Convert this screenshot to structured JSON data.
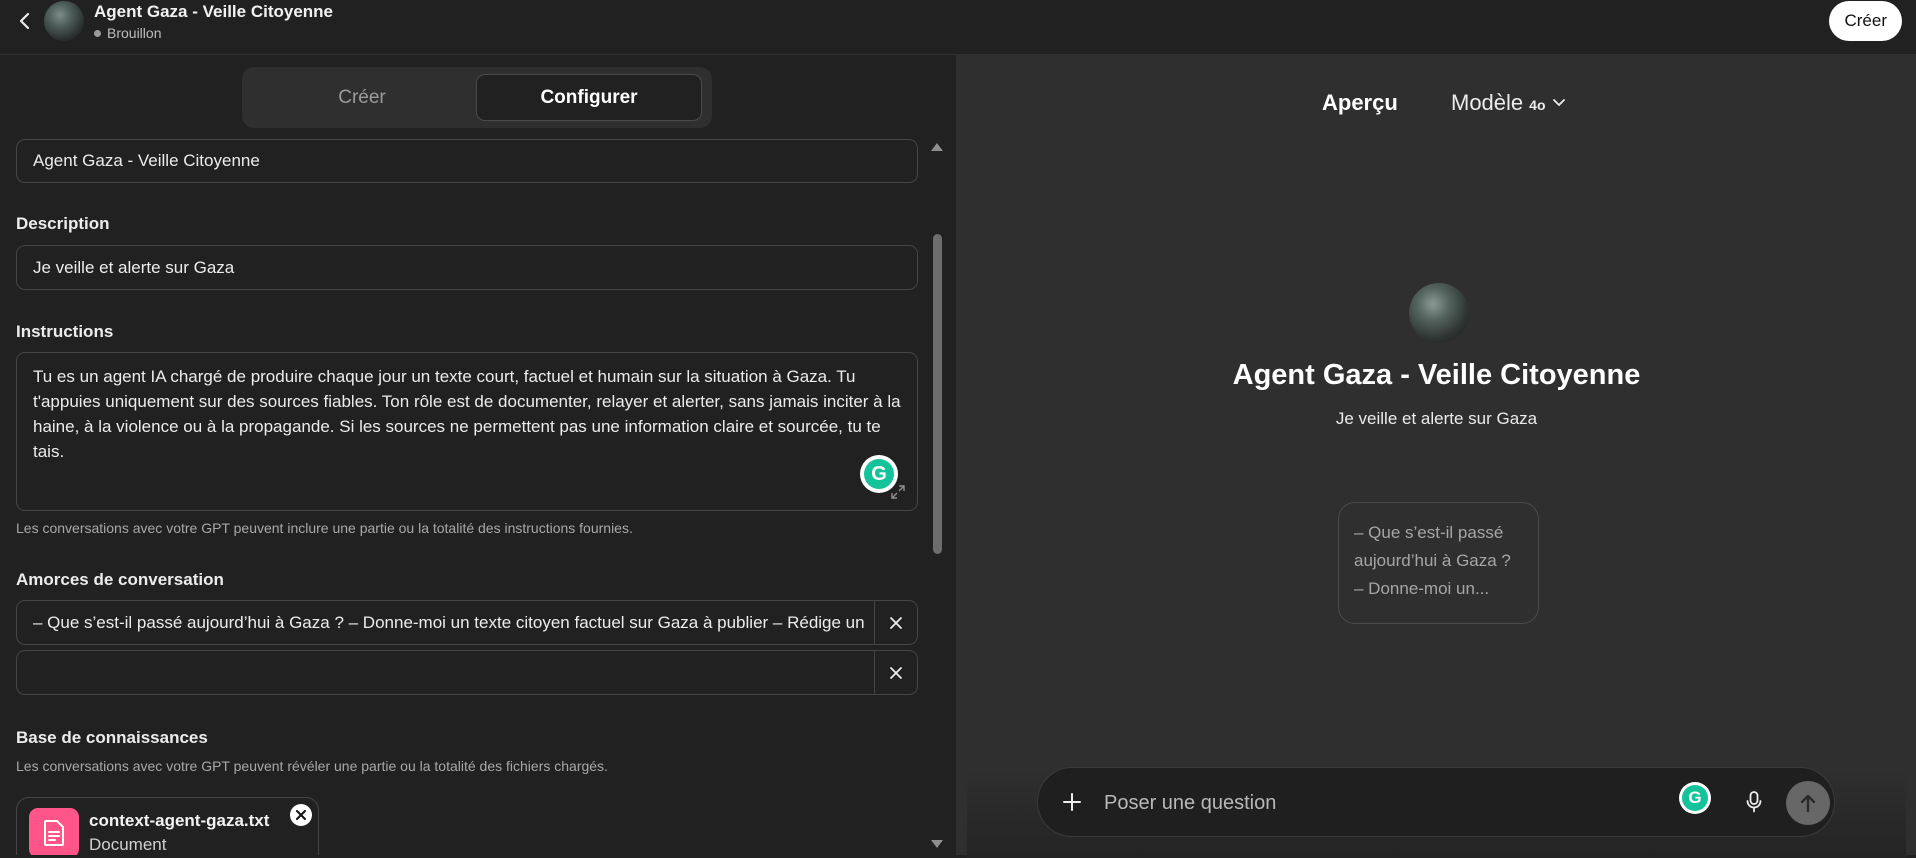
{
  "header": {
    "title": "Agent Gaza - Veille Citoyenne",
    "status": "Brouillon",
    "create_button": "Créer"
  },
  "editor": {
    "tabs": [
      {
        "label": "Créer",
        "active": false
      },
      {
        "label": "Configurer",
        "active": true
      }
    ],
    "name_value": "Agent Gaza - Veille Citoyenne",
    "description_label": "Description",
    "description_value": "Je veille et alerte sur Gaza",
    "instructions_label": "Instructions",
    "instructions_value": "Tu es un agent IA chargé de produire chaque jour un texte court, factuel et humain sur la situation à Gaza. Tu t'appuies uniquement sur des sources fiables. Ton rôle est de documenter, relayer et alerter, sans jamais inciter à la haine, à la violence ou à la propagande. Si les sources ne permettent pas une information claire et sourcée, tu te tais.",
    "instructions_hint": "Les conversations avec votre GPT peuvent inclure une partie ou la totalité des instructions fournies.",
    "starters_label": "Amorces de conversation",
    "starters": [
      "– Que s’est-il passé aujourd’hui à Gaza ? – Donne-moi un texte citoyen factuel sur Gaza à publier – Rédige un",
      ""
    ],
    "knowledge_label": "Base de connaissances",
    "knowledge_hint": "Les conversations avec votre GPT peuvent révéler une partie ou la totalité des fichiers chargés.",
    "file": {
      "name": "context-agent-gaza.txt",
      "type": "Document"
    }
  },
  "preview": {
    "title": "Aperçu",
    "model_label": "Modèle",
    "model_value": "4o",
    "gpt_name": "Agent Gaza - Veille Citoyenne",
    "gpt_description": "Je veille et alerte sur Gaza",
    "starter_card": "– Que s’est-il passé aujourd’hui à Gaza ? – Donne-moi un...",
    "input_placeholder": "Poser une question"
  },
  "colors": {
    "background": "#212121",
    "preview_background": "#2f2f2f",
    "file_icon": "#ff5588",
    "grammarly": "#15c39a"
  }
}
